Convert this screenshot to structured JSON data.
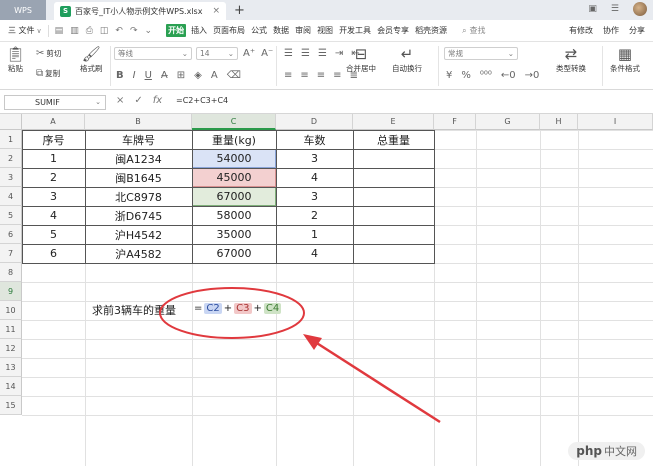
{
  "titlebar": {
    "app_tab": "WPS",
    "doc_icon": "S",
    "doc_tab": "百家号_IT小人物示例文件WPS.xlsx",
    "close": "×",
    "add": "+"
  },
  "menubar": {
    "file": "三 文件",
    "file_caret": "∨",
    "tabs": [
      {
        "label": "开始",
        "active": true
      },
      {
        "label": "插入"
      },
      {
        "label": "页面布局"
      },
      {
        "label": "公式"
      },
      {
        "label": "数据"
      },
      {
        "label": "审阅"
      },
      {
        "label": "视图"
      },
      {
        "label": "开发工具"
      },
      {
        "label": "会员专享"
      },
      {
        "label": "稻壳资源"
      }
    ],
    "search": "查找",
    "right": [
      "有修改",
      "协作",
      "分享"
    ]
  },
  "ribbon": {
    "cut": "剪切",
    "copy": "复制",
    "paste": "粘贴",
    "format_painter": "格式刷",
    "font_name": "等线",
    "font_size": "14",
    "merge": "合并居中",
    "wrap": "自动换行",
    "number_format": "常规",
    "type_convert": "类型转换",
    "cond_format": "条件格式"
  },
  "formulabar": {
    "name": "SUMIF",
    "cancel": "×",
    "confirm": "✓",
    "fx": "fx",
    "formula": "=C2+C3+C4"
  },
  "columns": [
    "A",
    "B",
    "C",
    "D",
    "E",
    "F",
    "G",
    "H",
    "I"
  ],
  "rows": [
    "1",
    "2",
    "3",
    "4",
    "5",
    "6",
    "7",
    "8",
    "9",
    "10",
    "11",
    "12",
    "13",
    "14",
    "15"
  ],
  "table": {
    "headers": [
      "序号",
      "车牌号",
      "重量(kg)",
      "车数",
      "总重量"
    ],
    "data": [
      [
        "1",
        "闽A1234",
        "54000",
        "3",
        ""
      ],
      [
        "2",
        "闽B1645",
        "45000",
        "4",
        ""
      ],
      [
        "3",
        "北C8978",
        "67000",
        "3",
        ""
      ],
      [
        "4",
        "浙D6745",
        "58000",
        "2",
        ""
      ],
      [
        "5",
        "沪H4542",
        "35000",
        "1",
        ""
      ],
      [
        "6",
        "沪A4582",
        "67000",
        "4",
        ""
      ]
    ]
  },
  "row9": {
    "label": "求前3辆车的重量",
    "formula_parts": {
      "eq": "=",
      "c2": "C2",
      "plus1": "+",
      "c3": "C3",
      "plus2": "+",
      "c4": "C4"
    }
  },
  "colors": {
    "accent_green": "#2aa052",
    "annotation_red": "#e0393e",
    "highlight_blue": "#dae3f6",
    "highlight_red": "#f3d0d0",
    "highlight_green": "#e2ecdc"
  },
  "watermark": {
    "logo": "php",
    "text": "中文网"
  }
}
